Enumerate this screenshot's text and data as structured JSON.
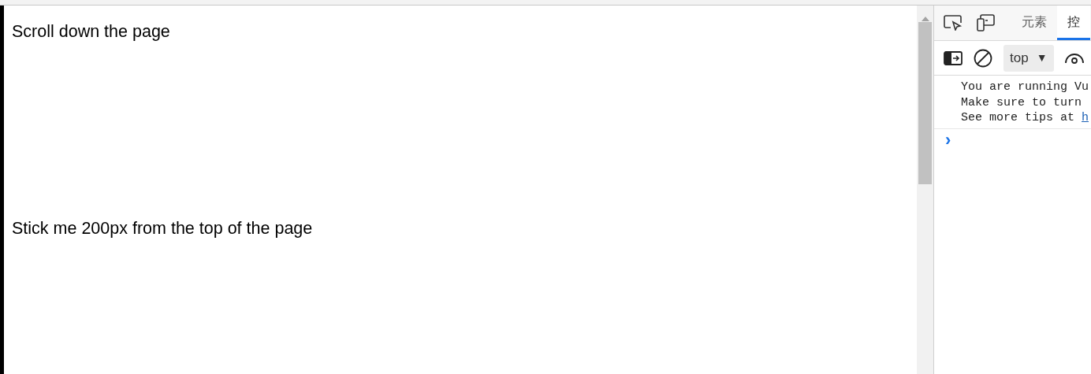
{
  "page": {
    "texts": [
      "Scroll down the page",
      "Stick me 200px from the top of the page"
    ]
  },
  "devtools": {
    "tabs": [
      {
        "label": "元素",
        "selected": false
      },
      {
        "label": "控",
        "selected": true
      }
    ],
    "context_selector": {
      "value": "top",
      "arrow": "▼"
    },
    "console": {
      "lines": [
        {
          "text": "You are running Vu"
        },
        {
          "text": "Make sure to turn"
        },
        {
          "text": "See more tips at ",
          "link": "h"
        }
      ],
      "prompt": "›"
    }
  }
}
